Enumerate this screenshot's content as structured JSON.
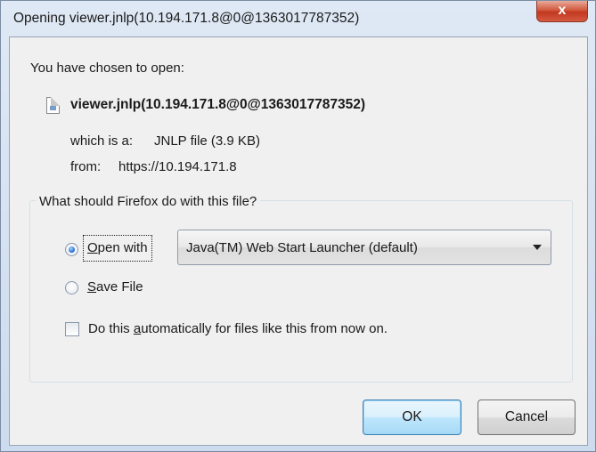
{
  "window": {
    "title": "Opening viewer.jnlp(10.194.171.8@0@1363017787352)",
    "close_glyph": "x"
  },
  "file": {
    "intro": "You have chosen to open:",
    "icon": "document-icon",
    "name": "viewer.jnlp(10.194.171.8@0@1363017787352)",
    "type_label": "which is a:",
    "type_value": "JNLP file (3.9 KB)",
    "from_label": "from:",
    "from_value": "https://10.194.171.8"
  },
  "action": {
    "group_title": "What should Firefox do with this file?",
    "open_with": {
      "underlined_char": "O",
      "rest": "pen with",
      "selected": true
    },
    "application": "Java(TM) Web Start Launcher (default)",
    "save_file": {
      "underlined_char": "S",
      "rest": "ave File",
      "selected": false
    },
    "auto": {
      "before": "Do this ",
      "underlined_char": "a",
      "after": "utomatically for files like this from now on.",
      "checked": false
    }
  },
  "buttons": {
    "ok": "OK",
    "cancel": "Cancel"
  }
}
